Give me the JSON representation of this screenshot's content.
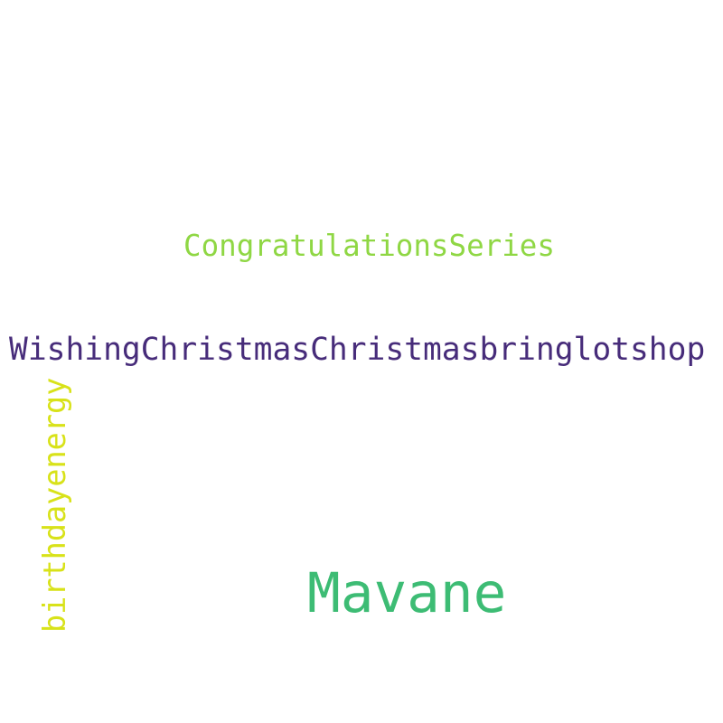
{
  "words": [
    {
      "text": "CongratulationsSeries",
      "color": "#8fd744",
      "orientation": "horizontal"
    },
    {
      "text": "WishingChristmasChristmasbringlotshop",
      "color": "#472c7a",
      "orientation": "horizontal"
    },
    {
      "text": "birthdayenergy",
      "color": "#d8e219",
      "orientation": "vertical"
    },
    {
      "text": "Mavane",
      "color": "#3dbc74",
      "orientation": "horizontal"
    }
  ]
}
